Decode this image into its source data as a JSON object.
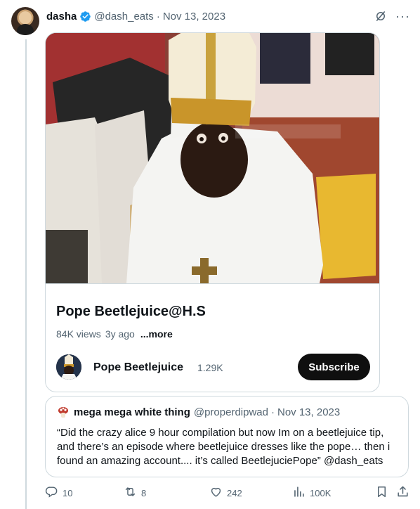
{
  "tweet": {
    "author_name": "dasha",
    "author_handle": "@dash_eats",
    "separator": "·",
    "date": "Nov 13, 2023",
    "icons": {
      "verified": "verified-badge-icon",
      "grok": "grok-icon",
      "more": "more-icon"
    },
    "more_glyph": "···"
  },
  "video_card": {
    "title": "Pope Beetlejuice@H.S",
    "views": "84K views",
    "age": "3y ago",
    "more_label": "...more",
    "channel_name": "Pope Beetlejuice",
    "subscriber_count": "1.29K",
    "subscribe_label": "Subscribe"
  },
  "quoted_tweet": {
    "author_name": "mega mega white thing",
    "author_handle": "@properdipwad",
    "separator": "·",
    "date": "Nov 13, 2023",
    "text": "“Did the crazy alice 9 hour compilation but now Im on a beetlejuice tip, and there’s an episode where beetlejuice dresses like the pope… then i found an amazing account.... it’s called BeetlejuciePope” @dash_eats"
  },
  "actions": {
    "replies": "10",
    "reposts": "8",
    "likes": "242",
    "views": "100K"
  },
  "colors": {
    "text_primary": "#0f1419",
    "text_secondary": "#536471",
    "border": "#cfd9de",
    "verified_blue": "#1d9bf0",
    "subscribe_bg": "#0f0f0f"
  }
}
